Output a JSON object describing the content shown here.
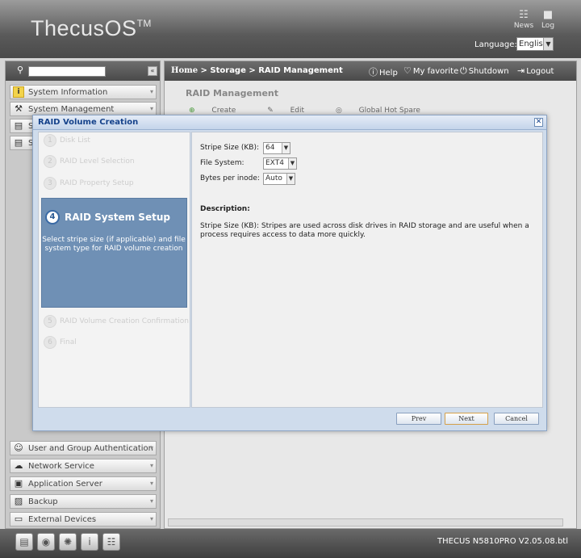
{
  "header": {
    "logo": "ThecusOS",
    "logo_tm": "TM",
    "news_label": "News",
    "log_label": "Log",
    "language_label": "Language:",
    "language_value": "English"
  },
  "sidebar": {
    "search_placeholder": "",
    "items_top": [
      {
        "label": "System Information",
        "icon": "info-icon"
      },
      {
        "label": "System Management",
        "icon": "tools-icon"
      }
    ],
    "partial_items": [
      "St",
      "St"
    ],
    "items_bottom": [
      {
        "label": "User and Group Authentication",
        "icon": "users-icon"
      },
      {
        "label": "Network Service",
        "icon": "network-icon"
      },
      {
        "label": "Application Server",
        "icon": "app-icon"
      },
      {
        "label": "Backup",
        "icon": "backup-icon"
      },
      {
        "label": "External Devices",
        "icon": "device-icon"
      }
    ]
  },
  "main": {
    "breadcrumb_home": "Home",
    "breadcrumb_rest": " > Storage > RAID Management",
    "links": {
      "help": "Help",
      "favorite": "My favorite",
      "shutdown": "Shutdown",
      "logout": "Logout"
    },
    "panel_title": "RAID Management",
    "toolbar": {
      "create": "Create",
      "edit": "Edit",
      "hot_spare": "Global Hot Spare"
    }
  },
  "dialog": {
    "title": "RAID Volume Creation",
    "steps": [
      {
        "num": "1",
        "label": "Disk List"
      },
      {
        "num": "2",
        "label": "RAID Level Selection"
      },
      {
        "num": "3",
        "label": "RAID Property Setup"
      },
      {
        "num": "5",
        "label": "RAID Volume Creation Confirmation"
      },
      {
        "num": "6",
        "label": "Final"
      }
    ],
    "active_step": {
      "num": "4",
      "label": "RAID System Setup",
      "description": "Select stripe size (if applicable) and file system type for RAID volume creation"
    },
    "form": {
      "stripe_label": "Stripe Size (KB):",
      "stripe_value": "64",
      "fs_label": "File System:",
      "fs_value": "EXT4",
      "inode_label": "Bytes per inode:",
      "inode_value": "Auto"
    },
    "description_title": "Description:",
    "description_text": "Stripe Size (KB): Stripes are used across disk drives in RAID storage and are useful when a process requires access to data more quickly.",
    "buttons": {
      "prev": "Prev",
      "next": "Next",
      "cancel": "Cancel"
    }
  },
  "footer": {
    "version": "THECUS N5810PRO V2.05.08.btl"
  }
}
